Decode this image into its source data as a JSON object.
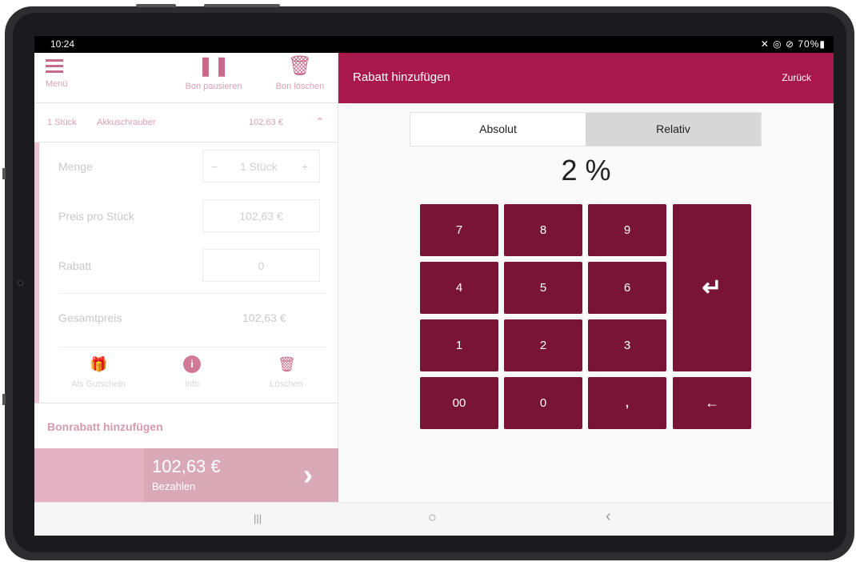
{
  "status": {
    "time": "10:24",
    "icons": "✕ ◎ ⊘ 70%▮"
  },
  "toolbar": {
    "menu_label": "Menü",
    "pause_label": "Bon pausieren",
    "delete_label": "Bon löschen"
  },
  "item": {
    "qty": "1 Stück",
    "name": "Akkuschrauber",
    "price": "102,63 €",
    "chevron": "⌃"
  },
  "detail": {
    "menge_label": "Menge",
    "menge_value": "1 Stück",
    "minus": "−",
    "plus": "+",
    "preis_label": "Preis pro Stück",
    "preis_value": "102,63 €",
    "rabatt_label": "Rabatt",
    "rabatt_value": "0",
    "gesamt_label": "Gesamtpreis",
    "gesamt_value": "102,63 €"
  },
  "actions": {
    "gift_label": "Als Gutschein",
    "info_label": "Info",
    "delete_label": "Löschen",
    "info_glyph": "i"
  },
  "bonrabatt_label": "Bonrabatt hinzufügen",
  "pay": {
    "amount": "102,63 €",
    "label": "Bezahlen",
    "arrow": "›"
  },
  "header": {
    "title": "Rabatt hinzufügen",
    "back": "Zurück"
  },
  "tabs": {
    "absolut": "Absolut",
    "relativ": "Relativ"
  },
  "display_value": "2 %",
  "keypad": {
    "k7": "7",
    "k8": "8",
    "k9": "9",
    "k4": "4",
    "k5": "5",
    "k6": "6",
    "k1": "1",
    "k2": "2",
    "k3": "3",
    "k00": "00",
    "k0": "0",
    "kcomma": ",",
    "enter": "↵",
    "backspace": "←"
  },
  "navbar": {
    "recent": "|||",
    "home": "○",
    "back": "‹"
  },
  "colors": {
    "brand": "#a8184a",
    "key": "#7a1436",
    "pay": "#d9a9b8"
  }
}
